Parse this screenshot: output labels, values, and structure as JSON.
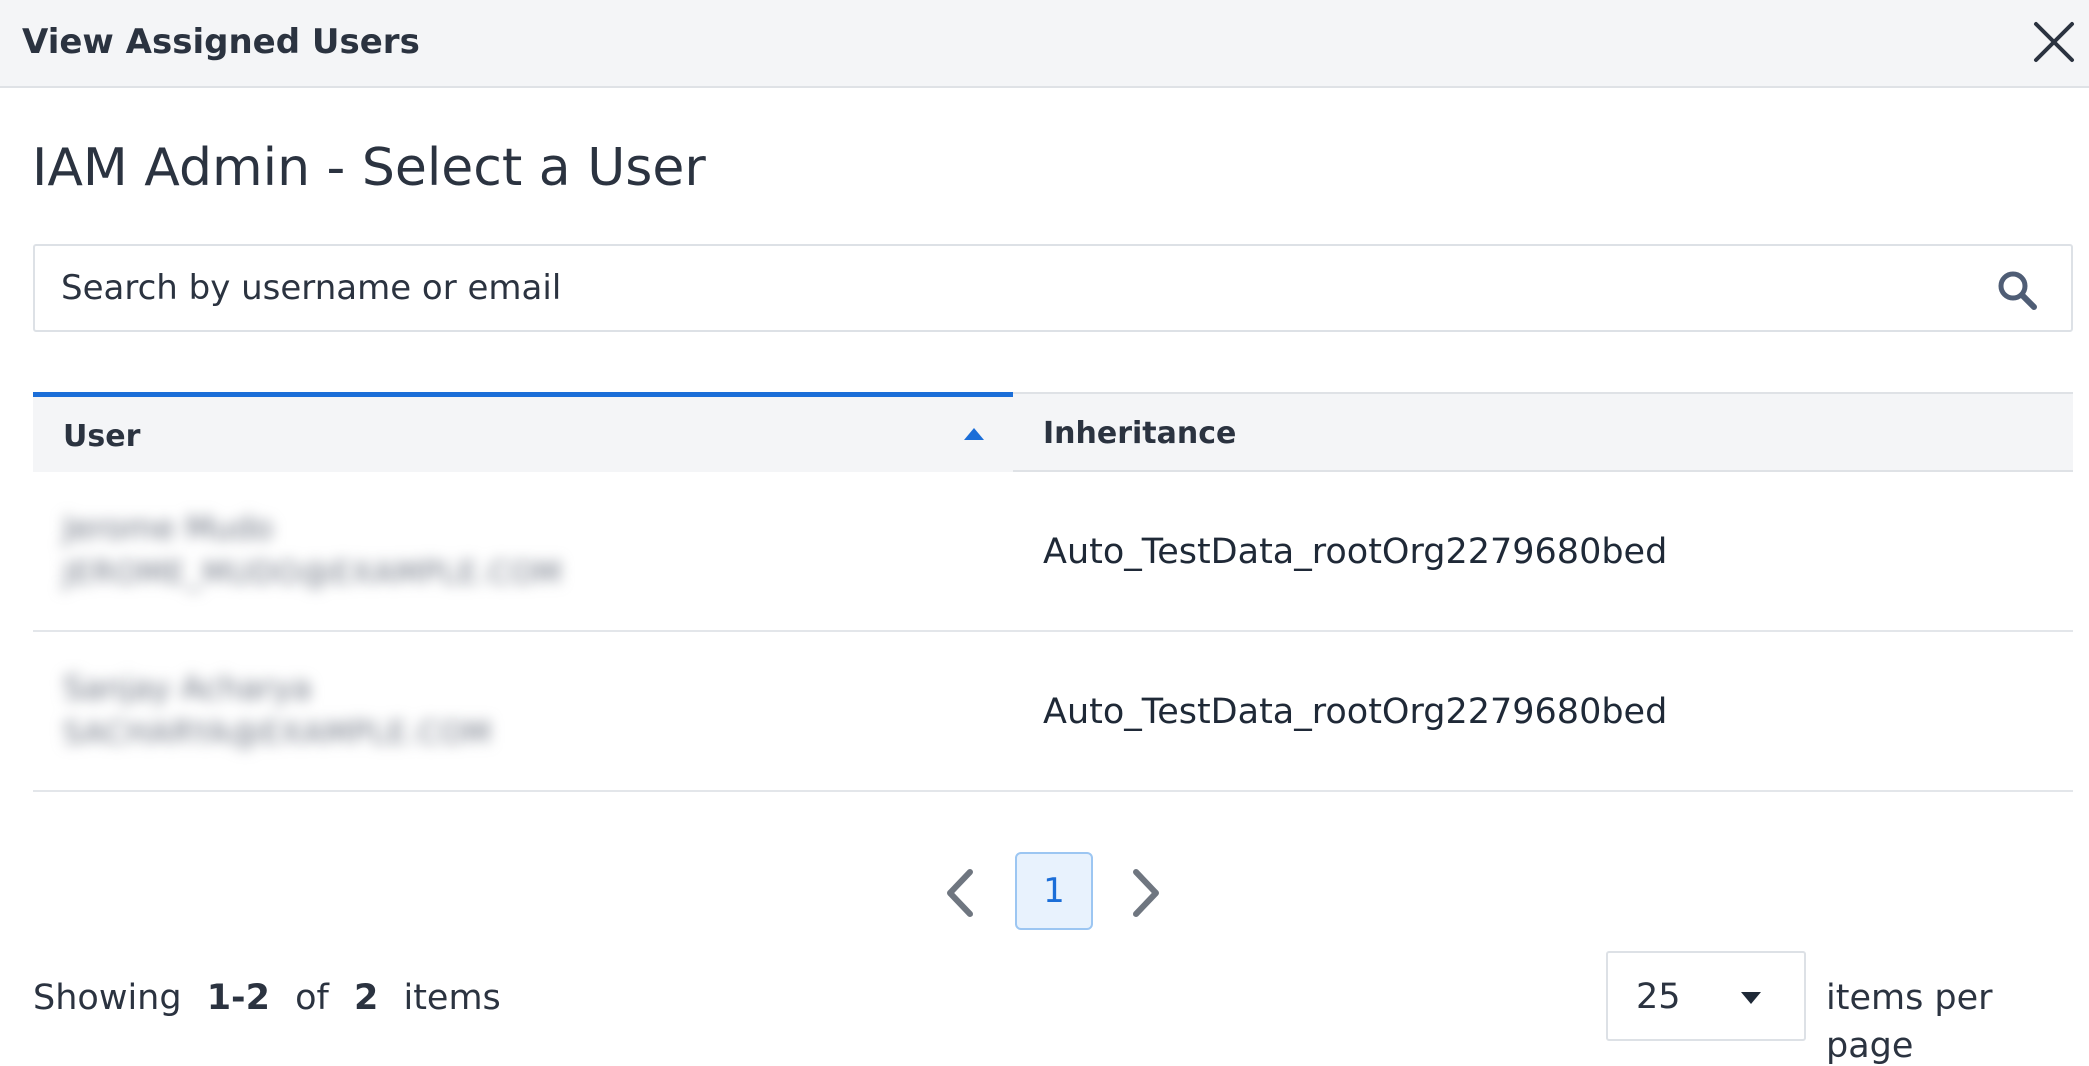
{
  "modal": {
    "title": "View Assigned Users",
    "close_icon": "close-icon"
  },
  "page": {
    "title": "IAM Admin - Select a User"
  },
  "search": {
    "placeholder": "Search by username or email",
    "value": "",
    "icon": "search-icon"
  },
  "table": {
    "columns": [
      {
        "label": "User",
        "sort": "ascending",
        "active": true
      },
      {
        "label": "Inheritance"
      }
    ],
    "rows": [
      {
        "name": "Jerome Mudo",
        "email": "JEROME_MUDO@EXAMPLE.COM",
        "inheritance": "Auto_TestData_rootOrg2279680bed"
      },
      {
        "name": "Sanjay Acharya",
        "email": "SACHARYA@EXAMPLE.COM",
        "inheritance": "Auto_TestData_rootOrg2279680bed"
      }
    ]
  },
  "pagination": {
    "prev_icon": "chevron-left-icon",
    "next_icon": "chevron-right-icon",
    "current_page": "1"
  },
  "footer": {
    "showing_word": "Showing",
    "range": "1-2",
    "of_word": "of",
    "total": "2",
    "items_word": "items",
    "per_page_value": "25",
    "per_page_label": "items per page"
  },
  "colors": {
    "accent": "#1b6ed8",
    "header_bg": "#f4f5f7",
    "text": "#2b3340",
    "page_active_bg": "#e8f2fd"
  }
}
